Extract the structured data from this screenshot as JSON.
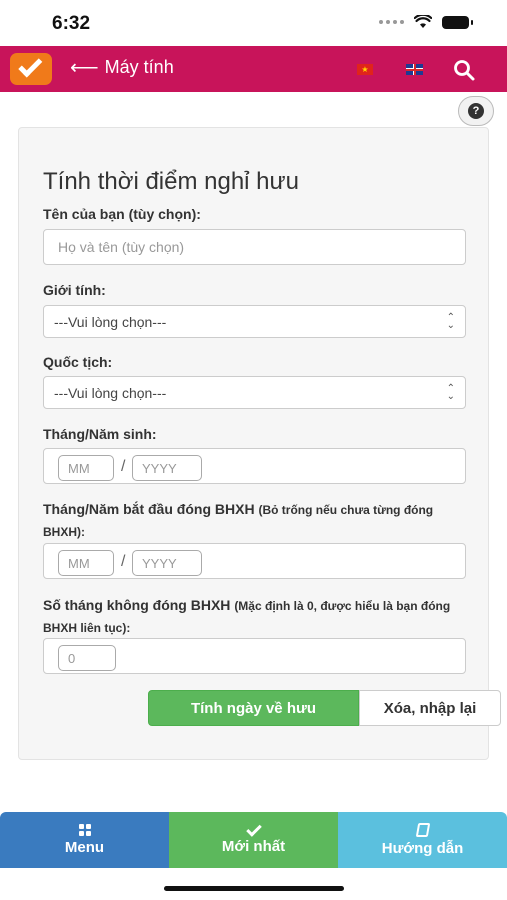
{
  "status_bar": {
    "time": "6:32"
  },
  "header": {
    "back_title": "Máy tính",
    "colors": {
      "header_bg": "#c8145a",
      "logo_bg": "#f07a1a"
    },
    "icons": [
      "back-arrow-icon",
      "vn-flag-icon",
      "uk-flag-icon",
      "search-icon"
    ]
  },
  "form": {
    "title": "Tính thời điểm nghỉ hưu",
    "name": {
      "label": "Tên của bạn (tùy chọn):",
      "placeholder": "Họ và tên (tùy chọn)"
    },
    "gender": {
      "label": "Giới tính:",
      "selected": "---Vui lòng chọn---"
    },
    "nationality": {
      "label": "Quốc tịch:",
      "selected": "---Vui lòng chọn---"
    },
    "birth": {
      "label": "Tháng/Năm sinh:",
      "month_placeholder": "MM",
      "year_placeholder": "YYYY",
      "separator": "/"
    },
    "insurance_start": {
      "label": "Tháng/Năm bắt đầu đóng BHXH",
      "note": "(Bỏ trống nếu chưa từng đóng BHXH):",
      "month_placeholder": "MM",
      "year_placeholder": "YYYY",
      "separator": "/"
    },
    "months_unpaid": {
      "label": "Số tháng không đóng BHXH",
      "note": "(Mặc định là 0, được hiểu là bạn đóng BHXH liên tục):",
      "placeholder": "0"
    },
    "buttons": {
      "calculate": "Tính ngày về hưu",
      "reset": "Xóa, nhập lại"
    },
    "colors": {
      "calculate_bg": "#5cb85c"
    }
  },
  "bottom_nav": {
    "menu": "Menu",
    "latest": "Mới nhất",
    "guide": "Hướng dẫn",
    "colors": {
      "menu": "#3a7bbf",
      "latest": "#5cb85c",
      "guide": "#5bc0de"
    }
  }
}
